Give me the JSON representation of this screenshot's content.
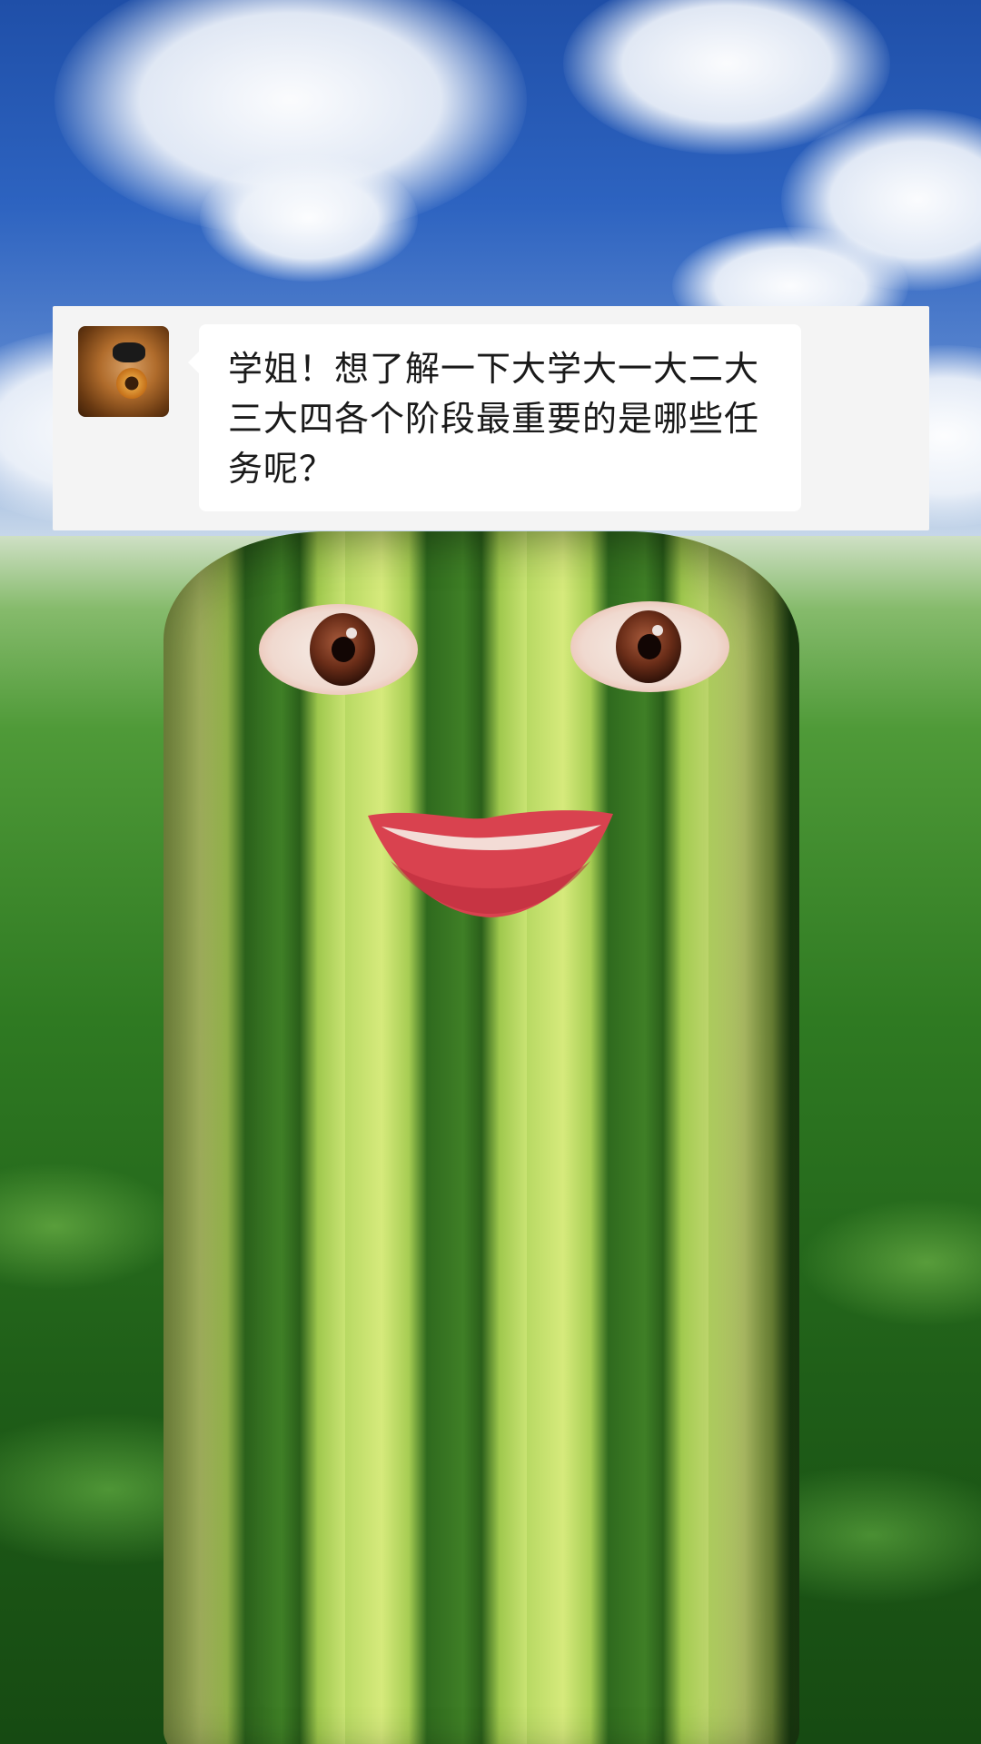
{
  "comment": {
    "text": "学姐！想了解一下大学大一大二大三大四各个阶段最重要的是哪些任务呢？"
  },
  "colors": {
    "card_background": "#f4f4f4",
    "bubble_background": "#ffffff",
    "text": "#1a1a1a",
    "sky": "#2d63c0",
    "field": "#3f8f2a"
  }
}
